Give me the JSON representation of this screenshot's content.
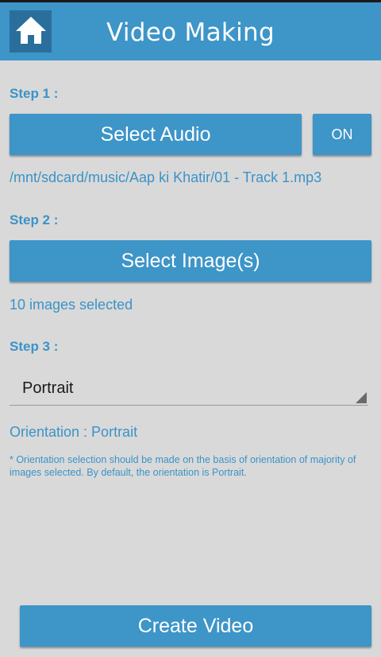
{
  "header": {
    "title": "Video Making",
    "home_icon": "home-icon"
  },
  "colors": {
    "accent": "#3d95c8",
    "accent_dark": "#2a6f9c",
    "background": "#d9d9d9",
    "info_text": "#3a93c8"
  },
  "step1": {
    "label": "Step 1 :",
    "select_audio_label": "Select Audio",
    "toggle_label": "ON",
    "audio_path": "/mnt/sdcard/music/Aap ki Khatir/01 - Track 1.mp3"
  },
  "step2": {
    "label": "Step 2 :",
    "select_images_label": "Select Image(s)",
    "images_status": "10 images selected"
  },
  "step3": {
    "label": "Step 3 :",
    "orientation_selected": "Portrait",
    "orientation_status": "Orientation : Portrait",
    "note": "* Orientation selection should be made on the basis of orientation of majority of images selected. By default, the orientation is Portrait."
  },
  "footer": {
    "create_video_label": "Create Video"
  }
}
